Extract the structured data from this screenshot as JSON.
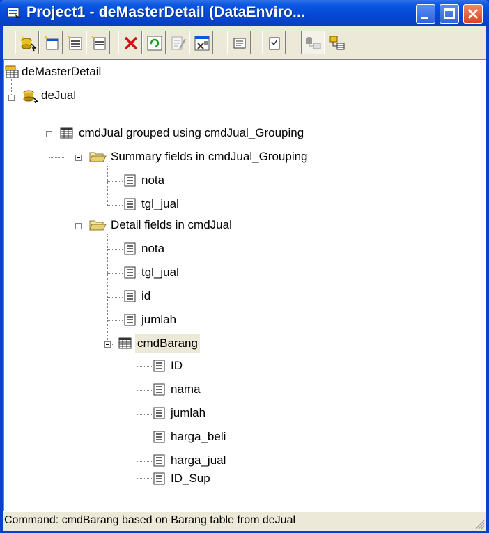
{
  "window": {
    "title": "Project1 - deMasterDetail (DataEnviro...",
    "colors": {
      "titlebar": "#0a56e0",
      "close": "#d8461e",
      "face": "#ece9d8"
    }
  },
  "toolbar": {
    "buttons": [
      "add-connection-icon",
      "add-command-icon",
      "insert-stored-procedures-icon",
      "add-child-command-icon",
      "delete-icon",
      "refresh-icon",
      "design-icon",
      "properties-icon",
      "view-code-icon",
      "options-icon",
      "arrange-by-connections-icon",
      "arrange-by-objects-icon"
    ]
  },
  "tree": {
    "root": "deMasterDetail",
    "connection": "deJual",
    "command": "cmdJual grouped using cmdJual_Grouping",
    "summary_folder": "Summary fields in cmdJual_Grouping",
    "summary_fields": [
      "nota",
      "tgl_jual"
    ],
    "detail_folder": "Detail fields in cmdJual",
    "detail_fields": [
      "nota",
      "tgl_jual",
      "id",
      "jumlah"
    ],
    "child_command": "cmdBarang",
    "child_fields": [
      "ID",
      "nama",
      "jumlah",
      "harga_beli",
      "harga_jual",
      "ID_Sup"
    ]
  },
  "status": {
    "text": "Command:  cmdBarang based on Barang  table  from deJual"
  }
}
